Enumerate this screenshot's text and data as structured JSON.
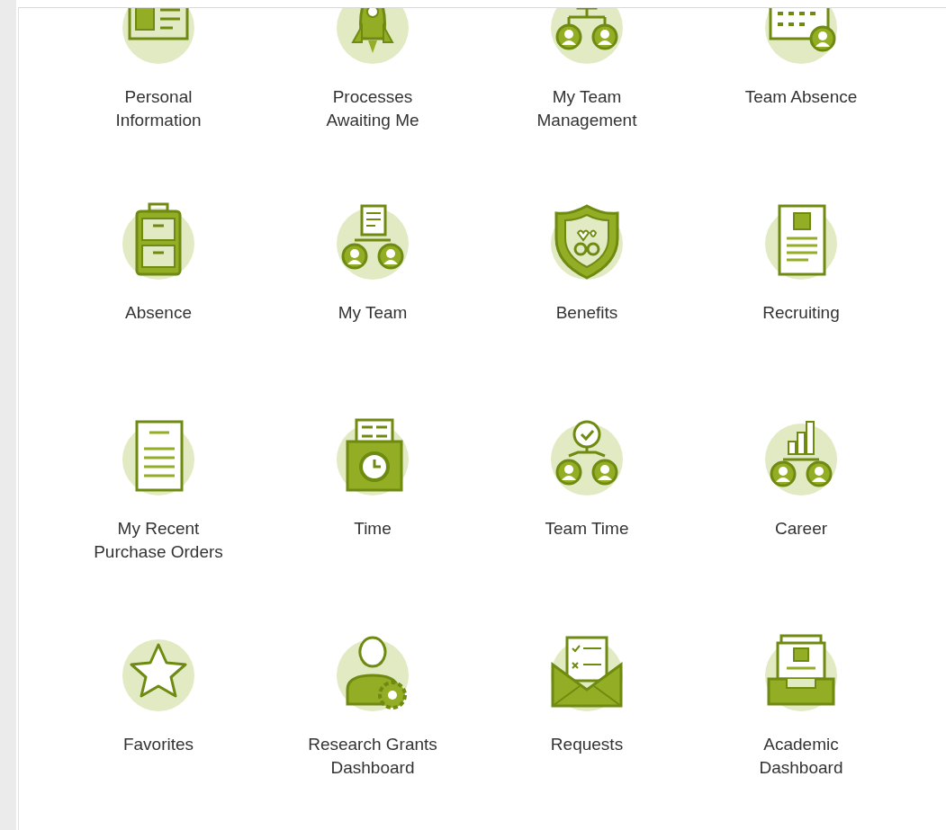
{
  "apps": [
    {
      "label": "Personal\nInformation"
    },
    {
      "label": "Processes\nAwaiting Me"
    },
    {
      "label": "My Team\nManagement"
    },
    {
      "label": "Team Absence"
    },
    {
      "label": "Absence"
    },
    {
      "label": "My Team"
    },
    {
      "label": "Benefits"
    },
    {
      "label": "Recruiting"
    },
    {
      "label": "My Recent\nPurchase Orders"
    },
    {
      "label": "Time"
    },
    {
      "label": "Team Time"
    },
    {
      "label": "Career"
    },
    {
      "label": "Favorites"
    },
    {
      "label": "Research Grants\nDashboard"
    },
    {
      "label": "Requests"
    },
    {
      "label": "Academic\nDashboard"
    }
  ]
}
